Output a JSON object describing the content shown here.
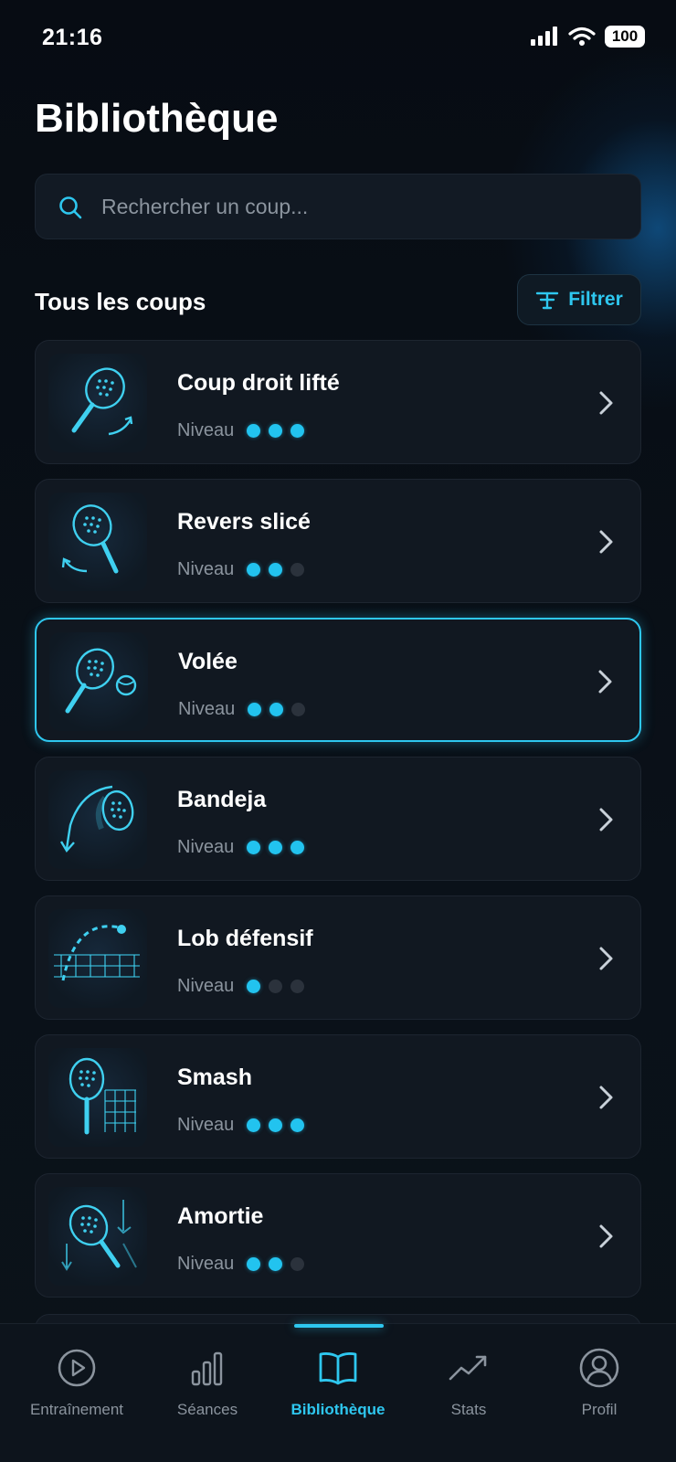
{
  "status_bar": {
    "time": "21:16",
    "battery": "100"
  },
  "page": {
    "title": "Bibliothèque"
  },
  "search": {
    "placeholder": "Rechercher un coup..."
  },
  "section": {
    "title": "Tous les coups",
    "filter_label": "Filtrer"
  },
  "level_label": "Niveau",
  "shots": [
    {
      "name": "Coup droit lifté",
      "level": 3,
      "icon": "racket-topspin-icon"
    },
    {
      "name": "Revers slicé",
      "level": 2,
      "icon": "racket-slice-icon"
    },
    {
      "name": "Volée",
      "level": 2,
      "icon": "racket-volley-icon",
      "selected": true
    },
    {
      "name": "Bandeja",
      "level": 3,
      "icon": "racket-bandeja-icon"
    },
    {
      "name": "Lob défensif",
      "level": 1,
      "icon": "lob-trajectory-icon"
    },
    {
      "name": "Smash",
      "level": 3,
      "icon": "racket-smash-icon"
    },
    {
      "name": "Amortie",
      "level": 2,
      "icon": "racket-dropshot-icon"
    }
  ],
  "tabs": [
    {
      "label": "Entraînement",
      "icon": "play-circle-icon"
    },
    {
      "label": "Séances",
      "icon": "bar-chart-icon"
    },
    {
      "label": "Bibliothèque",
      "icon": "book-icon",
      "active": true
    },
    {
      "label": "Stats",
      "icon": "trend-icon"
    },
    {
      "label": "Profil",
      "icon": "user-circle-icon"
    }
  ],
  "colors": {
    "accent": "#2ec7ef",
    "background": "#080d14",
    "card": "#111821",
    "muted": "#8b949e"
  }
}
